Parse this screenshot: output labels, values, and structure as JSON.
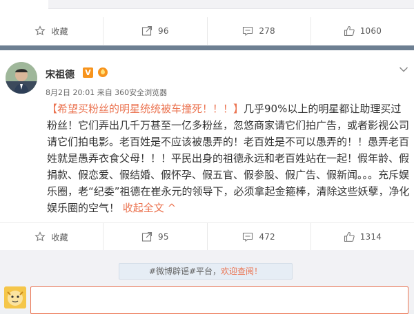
{
  "previous_post": {
    "actions": [
      {
        "label": "收藏",
        "icon": "star-icon"
      },
      {
        "label": "96",
        "icon": "repost-icon"
      },
      {
        "label": "278",
        "icon": "comment-icon"
      },
      {
        "label": "1060",
        "icon": "like-icon"
      }
    ]
  },
  "post": {
    "author": "宋祖德",
    "verified_badge": "V",
    "meta": "8月2日 20:01 来自 360安全浏览器",
    "content_parts": {
      "topic": "【希望买粉丝的明星统统被车撞死！！！】",
      "body": "几乎90%以上的明星都让助理买过粉丝！它们弄出几千万甚至一亿多粉丝，忽悠商家请它们拍广告，或者影视公司请它们拍电影。老百姓是不应该被愚弄的！老百姓是不可以愚弄的！！愚弄老百姓就是愚弄衣食父母！！！平民出身的祖德永远和老百姓站在一起！假年龄、假捐款、假恋爱、假结婚、假怀孕、假五官、假参股、假广告、假新闻。。。充斥娱乐圈，老“纪委”祖德在崔永元的领导下，必须拿起金箍棒，清除这些妖孽，净化娱乐圈的空气！",
      "collapse_label": "收起全文 ^"
    },
    "actions": [
      {
        "label": "收藏",
        "icon": "star-icon"
      },
      {
        "label": "95",
        "icon": "repost-icon"
      },
      {
        "label": "472",
        "icon": "comment-icon"
      },
      {
        "label": "1314",
        "icon": "like-icon"
      }
    ]
  },
  "comment_section": {
    "notice_prefix": "#微博辟谣#平台，",
    "notice_link": "欢迎查阅！",
    "input_placeholder": ""
  },
  "colors": {
    "accent": "#eb7350",
    "separator": "#6d7f92",
    "badge_orange": "#f7941d"
  }
}
